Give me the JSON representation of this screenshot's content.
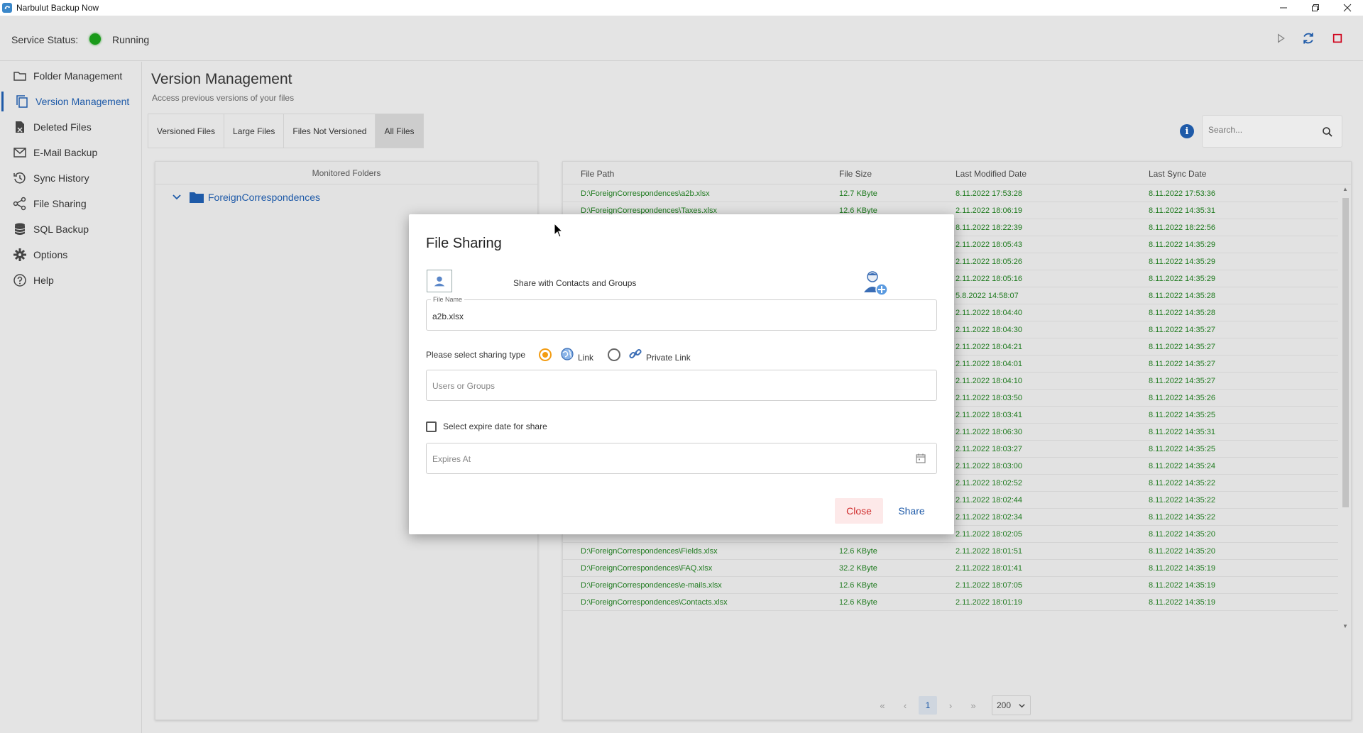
{
  "window": {
    "title": "Narbulut Backup Now"
  },
  "status": {
    "label": "Service Status:",
    "value": "Running",
    "color": "#1a9a1a"
  },
  "sidebar": {
    "items": [
      {
        "label": "Folder Management",
        "icon": "folder-icon"
      },
      {
        "label": "Version Management",
        "icon": "versions-icon",
        "active": true
      },
      {
        "label": "Deleted Files",
        "icon": "deleted-files-icon"
      },
      {
        "label": "E-Mail Backup",
        "icon": "mail-icon"
      },
      {
        "label": "Sync History",
        "icon": "history-icon"
      },
      {
        "label": "File Sharing",
        "icon": "share-icon"
      },
      {
        "label": "SQL Backup",
        "icon": "database-icon"
      },
      {
        "label": "Options",
        "icon": "gear-icon"
      },
      {
        "label": "Help",
        "icon": "help-icon"
      }
    ]
  },
  "header": {
    "title": "Version Management",
    "subtitle": "Access previous versions of your files",
    "tabs": [
      "Versioned Files",
      "Large Files",
      "Files Not Versioned",
      "All Files"
    ],
    "active_tab": "All Files",
    "search_placeholder": "Search..."
  },
  "folders": {
    "header": "Monitored Folders",
    "items": [
      "ForeignCorrespondences"
    ]
  },
  "files": {
    "columns": [
      "File Path",
      "File Size",
      "Last Modified Date",
      "Last Sync Date"
    ],
    "rows": [
      [
        "D:\\ForeignCorrespondences\\a2b.xlsx",
        "12.7 KByte",
        "8.11.2022 17:53:28",
        "8.11.2022 17:53:36"
      ],
      [
        "D:\\ForeignCorrespondences\\Taxes.xlsx",
        "12.6 KByte",
        "2.11.2022 18:06:19",
        "8.11.2022 14:35:31"
      ],
      [
        "",
        "",
        "8.11.2022 18:22:39",
        "8.11.2022 18:22:56"
      ],
      [
        "",
        "",
        "2.11.2022 18:05:43",
        "8.11.2022 14:35:29"
      ],
      [
        "",
        "",
        "2.11.2022 18:05:26",
        "8.11.2022 14:35:29"
      ],
      [
        "",
        "",
        "2.11.2022 18:05:16",
        "8.11.2022 14:35:29"
      ],
      [
        "",
        "",
        "5.8.2022 14:58:07",
        "8.11.2022 14:35:28"
      ],
      [
        "",
        "",
        "2.11.2022 18:04:40",
        "8.11.2022 14:35:28"
      ],
      [
        "",
        "",
        "2.11.2022 18:04:30",
        "8.11.2022 14:35:27"
      ],
      [
        "",
        "",
        "2.11.2022 18:04:21",
        "8.11.2022 14:35:27"
      ],
      [
        "",
        "",
        "2.11.2022 18:04:01",
        "8.11.2022 14:35:27"
      ],
      [
        "",
        "",
        "2.11.2022 18:04:10",
        "8.11.2022 14:35:27"
      ],
      [
        "",
        "",
        "2.11.2022 18:03:50",
        "8.11.2022 14:35:26"
      ],
      [
        "",
        "",
        "2.11.2022 18:03:41",
        "8.11.2022 14:35:25"
      ],
      [
        "",
        "",
        "2.11.2022 18:06:30",
        "8.11.2022 14:35:31"
      ],
      [
        "",
        "",
        "2.11.2022 18:03:27",
        "8.11.2022 14:35:25"
      ],
      [
        "",
        "",
        "2.11.2022 18:03:00",
        "8.11.2022 14:35:24"
      ],
      [
        "",
        "",
        "2.11.2022 18:02:52",
        "8.11.2022 14:35:22"
      ],
      [
        "",
        "",
        "2.11.2022 18:02:44",
        "8.11.2022 14:35:22"
      ],
      [
        "",
        "",
        "2.11.2022 18:02:34",
        "8.11.2022 14:35:22"
      ],
      [
        "",
        "",
        "2.11.2022 18:02:05",
        "8.11.2022 14:35:20"
      ],
      [
        "D:\\ForeignCorrespondences\\Fields.xlsx",
        "12.6 KByte",
        "2.11.2022 18:01:51",
        "8.11.2022 14:35:20"
      ],
      [
        "D:\\ForeignCorrespondences\\FAQ.xlsx",
        "32.2 KByte",
        "2.11.2022 18:01:41",
        "8.11.2022 14:35:19"
      ],
      [
        "D:\\ForeignCorrespondences\\e-mails.xlsx",
        "12.6 KByte",
        "2.11.2022 18:07:05",
        "8.11.2022 14:35:19"
      ],
      [
        "D:\\ForeignCorrespondences\\Contacts.xlsx",
        "12.6 KByte",
        "2.11.2022 18:01:19",
        "8.11.2022 14:35:19"
      ]
    ]
  },
  "pager": {
    "first": "«",
    "prev": "‹",
    "current": "1",
    "next": "›",
    "last": "»",
    "page_size": "200"
  },
  "modal": {
    "title": "File Sharing",
    "share_contacts_label": "Share with Contacts and Groups",
    "file_name_label": "File Name",
    "file_name_value": "a2b.xlsx",
    "sharing_type_label": "Please select sharing type",
    "option_link": "Link",
    "option_private_link": "Private Link",
    "users_placeholder": "Users or Groups",
    "expire_checkbox_label": "Select expire date for share",
    "expires_placeholder": "Expires At",
    "close_label": "Close",
    "share_label": "Share"
  },
  "colors": {
    "accent": "#1e5aa8",
    "file_text": "#1e7a1e",
    "radio": "#f39c12",
    "close_text": "#d03030",
    "stop": "#d0021b"
  }
}
